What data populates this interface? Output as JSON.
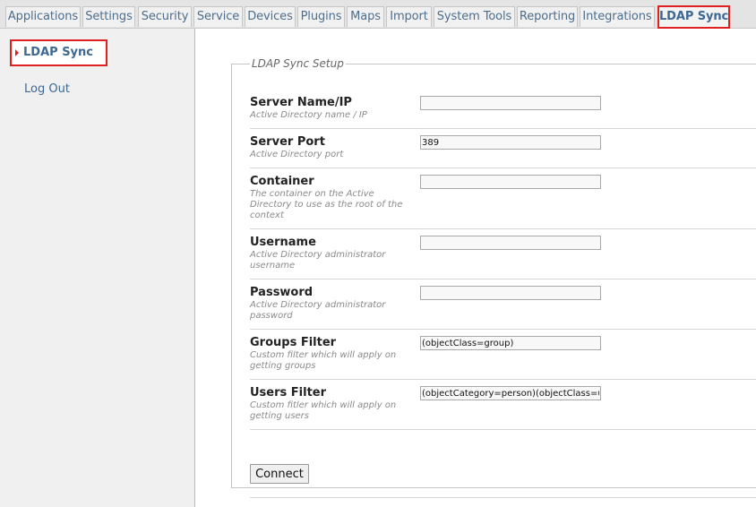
{
  "tabs": [
    {
      "label": "Applications"
    },
    {
      "label": "Settings"
    },
    {
      "label": "Security"
    },
    {
      "label": "Service"
    },
    {
      "label": "Devices"
    },
    {
      "label": "Plugins"
    },
    {
      "label": "Maps"
    },
    {
      "label": "Import"
    },
    {
      "label": "System Tools"
    },
    {
      "label": "Reporting"
    },
    {
      "label": "Integrations"
    },
    {
      "label": "LDAP Sync"
    }
  ],
  "sidebar": {
    "items": [
      {
        "label": "LDAP Sync"
      },
      {
        "label": "Log Out"
      }
    ]
  },
  "form": {
    "legend": "LDAP Sync Setup",
    "fields": [
      {
        "label": "Server Name/IP",
        "help": "Active Directory name / IP",
        "value": ""
      },
      {
        "label": "Server Port",
        "help": "Active Directory port",
        "value": "389"
      },
      {
        "label": "Container",
        "help": "The container on the Active Directory to use as the root of the context",
        "value": ""
      },
      {
        "label": "Username",
        "help": "Active Directory administrator username",
        "value": ""
      },
      {
        "label": "Password",
        "help": "Active Directory administrator password",
        "value": ""
      },
      {
        "label": "Groups Filter",
        "help": "Custom filter which will apply on getting groups",
        "value": "(objectClass=group)"
      },
      {
        "label": "Users Filter",
        "help": "Custom fitler which will apply on getting users",
        "value": "(objectCategory=person)(objectClass=user)"
      }
    ],
    "connect_label": "Connect"
  },
  "colors": {
    "highlight": "#e02020",
    "link": "#3d6894"
  }
}
